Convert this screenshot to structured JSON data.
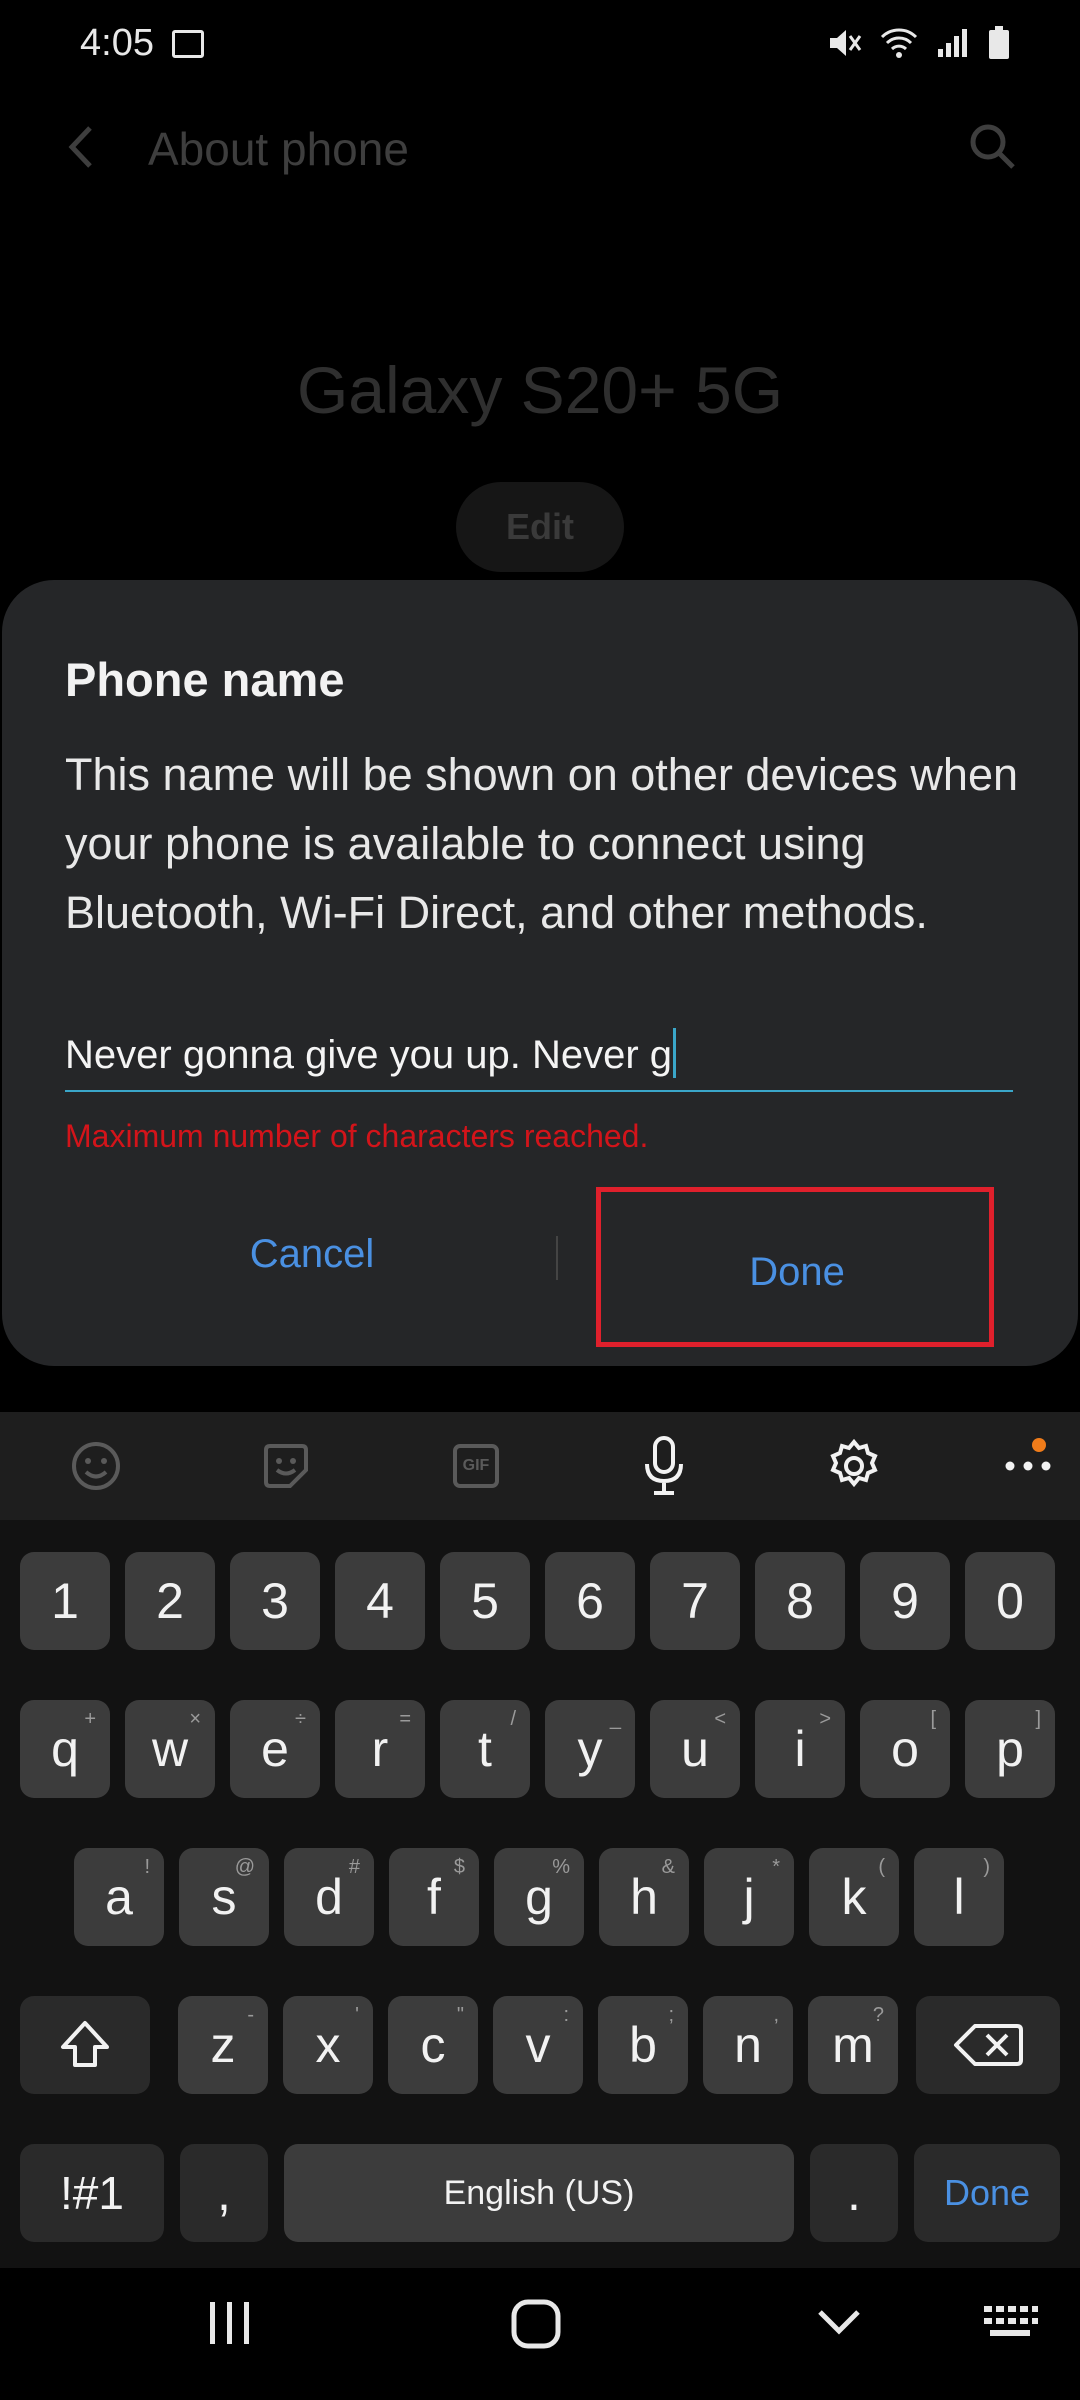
{
  "status_bar": {
    "time": "4:05"
  },
  "app_bar": {
    "title": "About phone"
  },
  "device": {
    "name": "Galaxy S20+ 5G",
    "edit_label": "Edit"
  },
  "dialog": {
    "title": "Phone name",
    "body": "This name will be shown on other devices when your phone is available to connect using Bluetooth, Wi-Fi Direct, and other methods.",
    "input_value": "Never gonna give you up. Never g",
    "error": "Maximum number of characters reached.",
    "cancel_label": "Cancel",
    "done_label": "Done"
  },
  "keyboard": {
    "row_numbers": [
      "1",
      "2",
      "3",
      "4",
      "5",
      "6",
      "7",
      "8",
      "9",
      "0"
    ],
    "row1": [
      {
        "k": "q",
        "s": "+"
      },
      {
        "k": "w",
        "s": "×"
      },
      {
        "k": "e",
        "s": "÷"
      },
      {
        "k": "r",
        "s": "="
      },
      {
        "k": "t",
        "s": "/"
      },
      {
        "k": "y",
        "s": "_"
      },
      {
        "k": "u",
        "s": "<"
      },
      {
        "k": "i",
        "s": ">"
      },
      {
        "k": "o",
        "s": "["
      },
      {
        "k": "p",
        "s": "]"
      }
    ],
    "row2": [
      {
        "k": "a",
        "s": "!"
      },
      {
        "k": "s",
        "s": "@"
      },
      {
        "k": "d",
        "s": "#"
      },
      {
        "k": "f",
        "s": "$"
      },
      {
        "k": "g",
        "s": "%"
      },
      {
        "k": "h",
        "s": "&"
      },
      {
        "k": "j",
        "s": "*"
      },
      {
        "k": "k",
        "s": "("
      },
      {
        "k": "l",
        "s": ")"
      }
    ],
    "row3": [
      {
        "k": "z",
        "s": "-"
      },
      {
        "k": "x",
        "s": "'"
      },
      {
        "k": "c",
        "s": "\""
      },
      {
        "k": "v",
        "s": ":"
      },
      {
        "k": "b",
        "s": ";"
      },
      {
        "k": "n",
        "s": ","
      },
      {
        "k": "m",
        "s": "?"
      }
    ],
    "symbols_label": "!#1",
    "comma_label": ",",
    "space_label": "English (US)",
    "period_label": ".",
    "done_label": "Done",
    "toolbar_icons": [
      "emoji-icon",
      "sticker-icon",
      "gif-icon",
      "microphone-icon",
      "settings-icon",
      "more-icon"
    ],
    "gif_label": "GIF"
  },
  "colors": {
    "accent": "#4a90e2",
    "error": "#d3141a",
    "highlight": "#e0202c",
    "underline": "#3aa6c9"
  }
}
